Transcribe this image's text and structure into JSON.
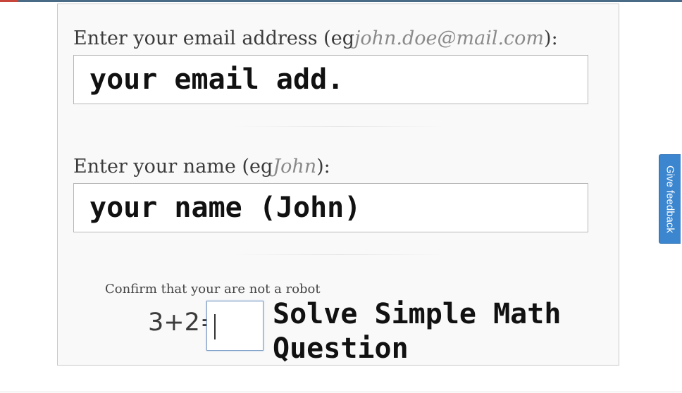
{
  "form": {
    "email": {
      "label_prefix": "Enter your email address (eg",
      "label_example": "john.doe@mail.com",
      "label_suffix": "):",
      "placeholder": "your email add."
    },
    "name": {
      "label_prefix": "Enter your name (eg",
      "label_example": "John",
      "label_suffix": "):",
      "placeholder": "your name (John)"
    },
    "captcha": {
      "label": "Confirm that your are not a robot",
      "question": "3+2=",
      "value": "",
      "hint": "Solve Simple Math Question"
    }
  },
  "feedback": {
    "label": "Give feedback"
  },
  "colors": {
    "feedback_tab": "#3b86cf",
    "card_background": "#f9f9f9",
    "example_text": "#8a8a8a",
    "captcha_border": "#7a9cc4"
  }
}
